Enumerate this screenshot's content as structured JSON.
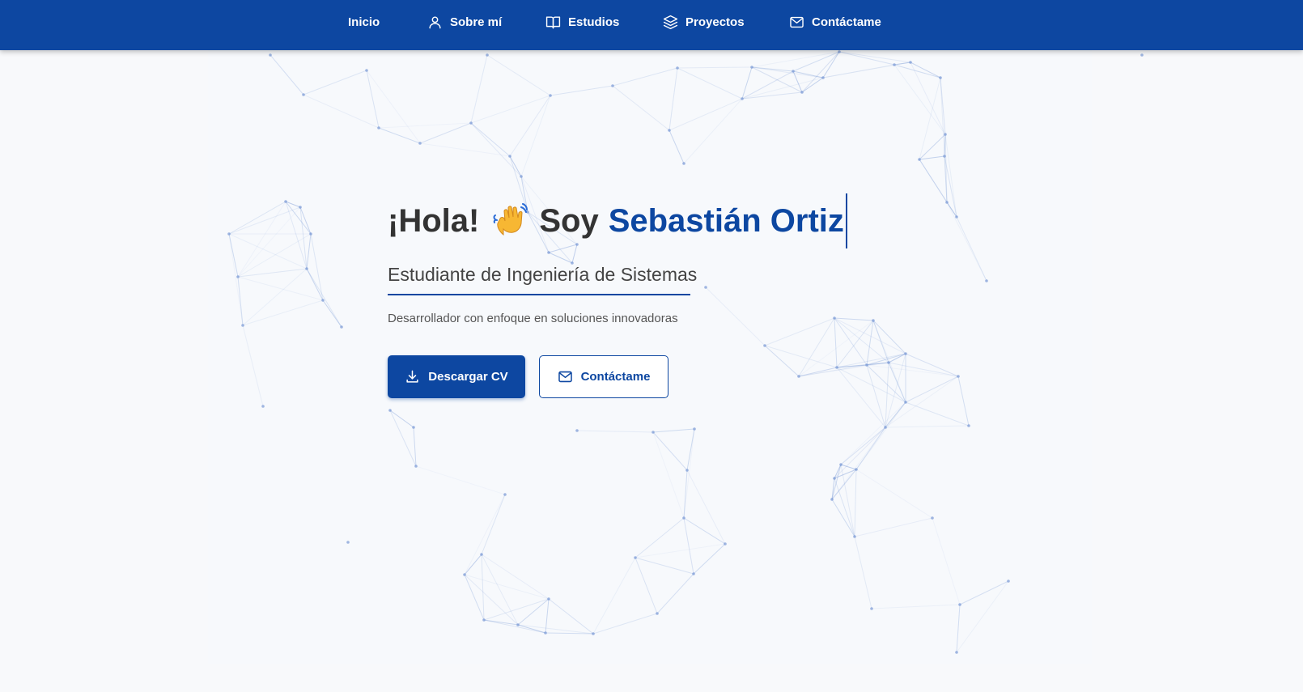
{
  "nav": {
    "items": [
      {
        "label": "Inicio",
        "icon": "none"
      },
      {
        "label": "Sobre mí",
        "icon": "user-icon"
      },
      {
        "label": "Estudios",
        "icon": "book-icon"
      },
      {
        "label": "Proyectos",
        "icon": "layers-icon"
      },
      {
        "label": "Contáctame",
        "icon": "mail-icon"
      }
    ]
  },
  "hero": {
    "greeting": "¡Hola!",
    "wave_emoji": "waving-hand-icon",
    "intro": "Soy",
    "name": "Sebastián Ortiz",
    "subtitle": "Estudiante de Ingeniería de Sistemas",
    "tagline": "Desarrollador con enfoque en soluciones innovadoras",
    "primary_button": "Descargar CV",
    "secondary_button": "Contáctame"
  },
  "colors": {
    "primary": "#0d47a1",
    "background": "#f8f9fb",
    "heading": "#333333",
    "network_line": "#7a9ad6"
  }
}
